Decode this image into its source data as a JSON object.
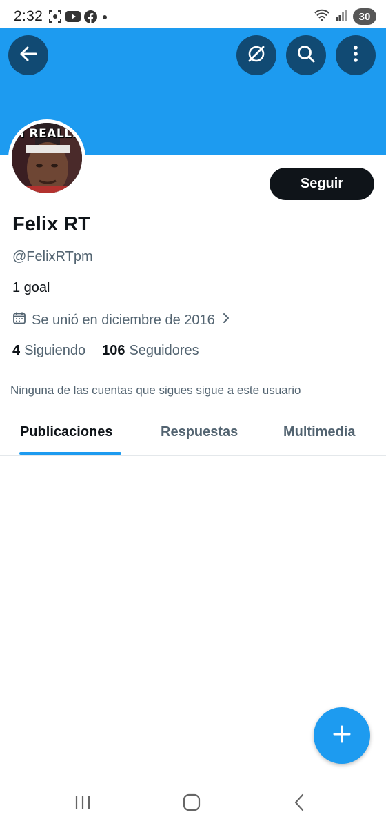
{
  "status_bar": {
    "time": "2:32",
    "battery": "30",
    "icons_left": [
      "screenshot-icon",
      "youtube-icon",
      "facebook-icon",
      "dot-icon"
    ],
    "icons_right": [
      "wifi-icon",
      "signal-icon",
      "battery-icon"
    ]
  },
  "header": {
    "banner_color": "#1d9bf0",
    "button_color": "#114a73",
    "buttons": [
      "back-icon",
      "grok-icon",
      "search-icon",
      "more-vertical-icon"
    ]
  },
  "profile": {
    "avatar_caption": "H REALLY",
    "follow_label": "Seguir",
    "display_name": "Felix RT",
    "handle": "@FelixRTpm",
    "bio": "1 goal",
    "joined": "Se unió en diciembre de 2016",
    "following_count": "4",
    "following_label": "Siguiendo",
    "followers_count": "106",
    "followers_label": "Seguidores",
    "mutuals_text": "Ninguna de las cuentas que sigues sigue a este usuario"
  },
  "tabs": [
    {
      "label": "Publicaciones",
      "active": true
    },
    {
      "label": "Respuestas",
      "active": false
    },
    {
      "label": "Multimedia",
      "active": false
    }
  ],
  "fab": {
    "icon": "plus-icon",
    "color": "#1d9bf0"
  },
  "nav_bar": {
    "buttons": [
      "recent-apps-icon",
      "home-icon",
      "back-nav-icon"
    ]
  }
}
